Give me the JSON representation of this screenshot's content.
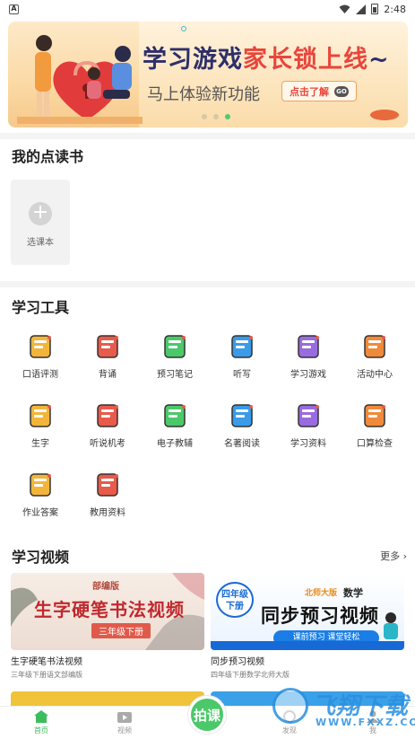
{
  "status_bar": {
    "time": "2:48",
    "app_icon_letter": "A"
  },
  "banner": {
    "title_part1": "学习游戏",
    "title_highlight": "家长锁上线",
    "title_part2": "~",
    "subtitle": "马上体验新功能",
    "cta_label": "点击了解",
    "cta_badge": "GO"
  },
  "my_books": {
    "title": "我的点读书",
    "select_label": "选课本"
  },
  "tools": {
    "title": "学习工具",
    "items": [
      {
        "label": "口语评测",
        "icon": "microphone-icon"
      },
      {
        "label": "背诵",
        "icon": "book-icon"
      },
      {
        "label": "预习笔记",
        "icon": "notebook-pen-icon"
      },
      {
        "label": "听写",
        "icon": "pencil-icon"
      },
      {
        "label": "学习游戏",
        "icon": "gamepad-icon"
      },
      {
        "label": "活动中心",
        "icon": "balloons-icon"
      },
      {
        "label": "生字",
        "icon": "character-card-icon"
      },
      {
        "label": "听说机考",
        "icon": "talk-bubble-icon"
      },
      {
        "label": "电子教辅",
        "icon": "e-book-icon"
      },
      {
        "label": "名著阅读",
        "icon": "open-book-icon"
      },
      {
        "label": "学习资料",
        "icon": "lightbulb-icon"
      },
      {
        "label": "口算检查",
        "icon": "magnifier-icon"
      },
      {
        "label": "作业答案",
        "icon": "homework-book-icon"
      },
      {
        "label": "教用资料",
        "icon": "teacher-board-icon"
      }
    ]
  },
  "videos": {
    "title": "学习视频",
    "more_label": "更多",
    "items": [
      {
        "title": "生字硬笔书法视频",
        "subtitle": "三年级下册语文部编版",
        "thumb_tag": "部编版",
        "thumb_title": "生字硬笔书法视频",
        "thumb_grade": "三年级下册"
      },
      {
        "title": "同步预习视频",
        "subtitle": "四年级下册数学北师大版",
        "thumb_badge_line1": "四年级",
        "thumb_badge_line2": "下册",
        "thumb_publisher": "北师大版",
        "thumb_subject": "数学",
        "thumb_title": "同步预习视频",
        "thumb_bar": "课前预习 课堂轻松"
      }
    ]
  },
  "tabbar": {
    "items": [
      {
        "label": "首页",
        "active": true
      },
      {
        "label": "视频",
        "active": false
      },
      {
        "label": "发现",
        "active": false
      },
      {
        "label": "我",
        "active": false
      }
    ],
    "center_label": "拍课"
  },
  "watermark": {
    "line1": "飞翔下载",
    "line2": "WWW.FXXZ.COM"
  },
  "colors": {
    "accent_green": "#4bc86a",
    "banner_red": "#e8463c",
    "banner_navy": "#2d2f6a",
    "video_blue": "#1769d6"
  }
}
